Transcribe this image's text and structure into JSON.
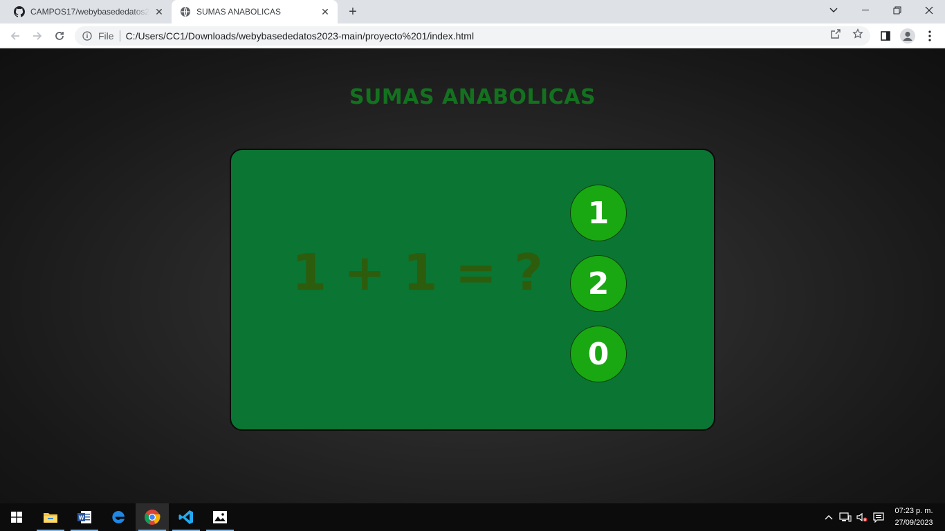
{
  "browser": {
    "tabs": [
      {
        "title": "CAMPOS17/webybasededatos2023",
        "icon": "github-icon",
        "active": false
      },
      {
        "title": "SUMAS ANABOLICAS",
        "icon": "globe-icon",
        "active": true
      }
    ],
    "address_bar": {
      "scheme_label": "File",
      "url": "C:/Users/CC1/Downloads/webybasededatos2023-main/proyecto%201/index.html"
    }
  },
  "page": {
    "title": "SUMAS ANABOLICAS",
    "question": "1 + 1 = ?",
    "answers": [
      "1",
      "2",
      "0"
    ]
  },
  "taskbar": {
    "apps": [
      "file-explorer-icon",
      "word-icon",
      "edge-icon",
      "chrome-icon",
      "vscode-icon",
      "photos-icon"
    ],
    "clock": {
      "time": "07:23 p. m.",
      "date": "27/09/2023"
    }
  },
  "colors": {
    "title_green": "#13711f",
    "card_green": "#0b7533",
    "question_green": "#2e5c0d",
    "answer_green": "#19a812"
  }
}
